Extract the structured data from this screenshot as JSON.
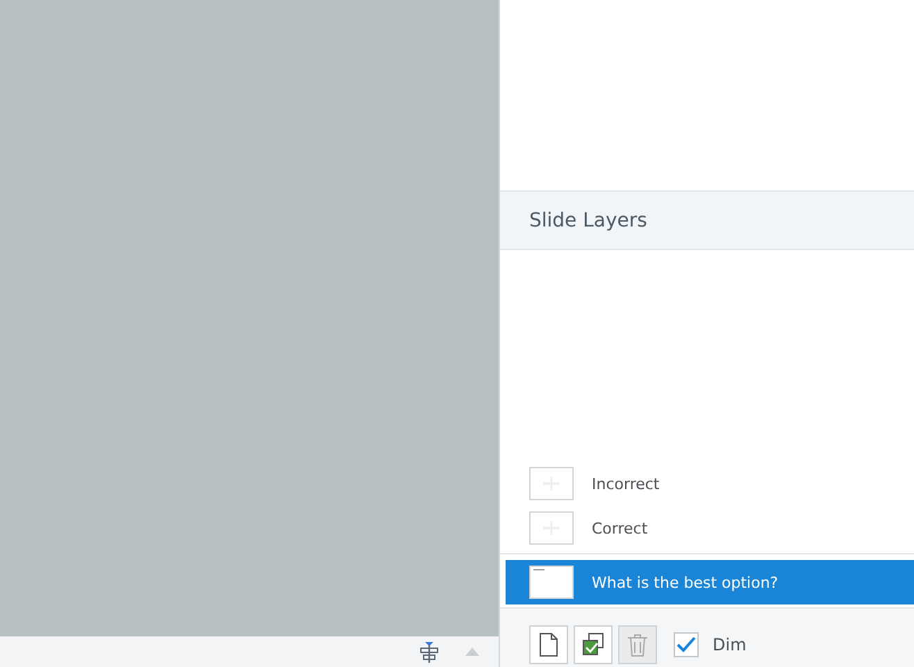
{
  "panel": {
    "title": "Slide Layers"
  },
  "layers": [
    {
      "name": "Incorrect",
      "kind": "layer",
      "selected": false
    },
    {
      "name": "Correct",
      "kind": "layer",
      "selected": false
    },
    {
      "name": "What is the best option?",
      "kind": "base",
      "selected": true
    }
  ],
  "toolbar": [
    {
      "kind": "new",
      "disabled": false
    },
    {
      "kind": "duplicate",
      "disabled": false
    },
    {
      "kind": "delete",
      "disabled": true
    }
  ],
  "dim": {
    "label": "Dim",
    "checked": true
  }
}
